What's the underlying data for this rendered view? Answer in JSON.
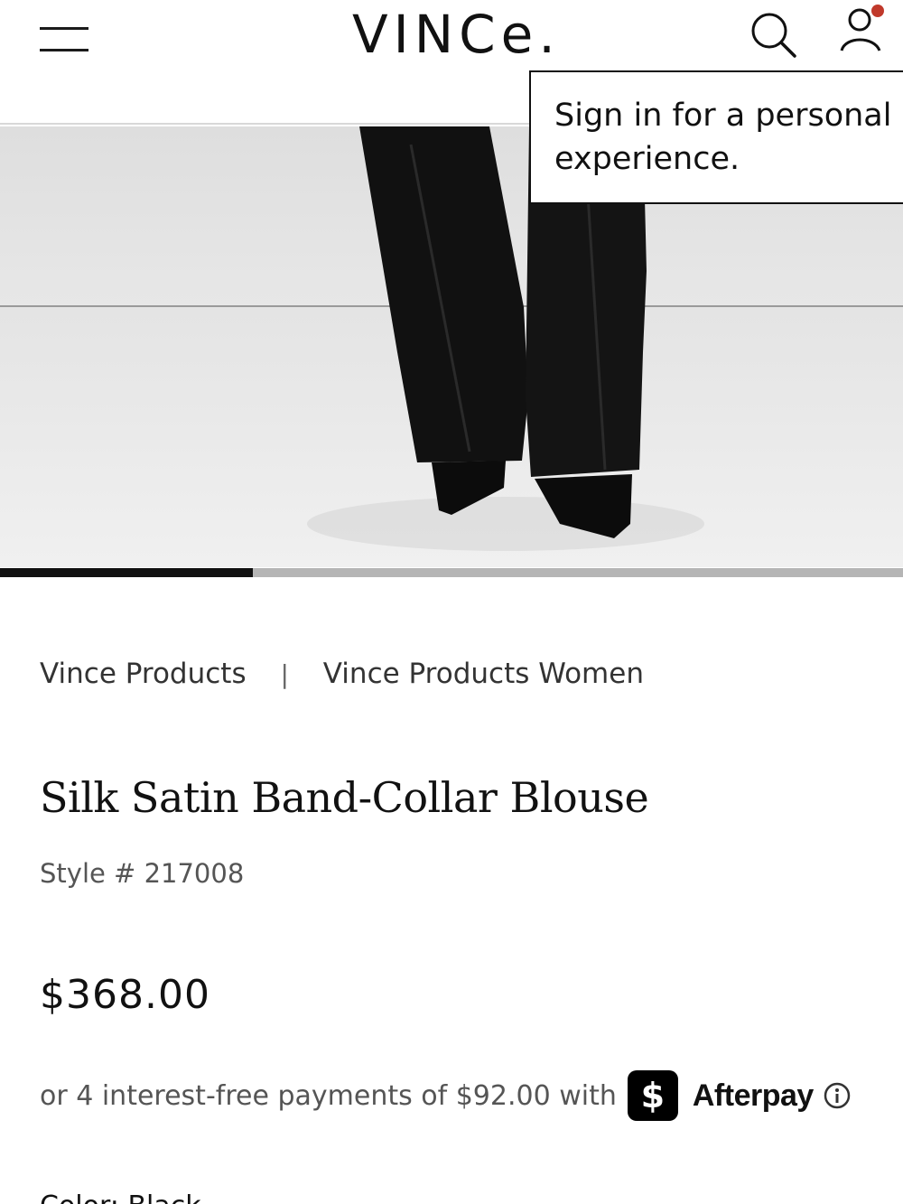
{
  "header": {
    "logo": "VINCe.",
    "menu_icon": "hamburger-menu-icon",
    "search_icon": "search-icon",
    "account_icon": "account-icon",
    "notification_dot_color": "#c0392b"
  },
  "tooltip": {
    "text_line1": "Sign in for a personal",
    "text_line2": "experience."
  },
  "carousel": {
    "progress": 0.28
  },
  "breadcrumb": {
    "items": [
      "Vince Products",
      "Vince Products Women"
    ],
    "separator": "|"
  },
  "product": {
    "title": "Silk Satin Band-Collar Blouse",
    "style": "Style # 217008",
    "price": "$368.00",
    "afterpay_text": "or 4 interest-free payments of $92.00 with",
    "afterpay_brand": "Afterpay",
    "cashapp_glyph": "$",
    "next_section_peek": "Color: Black"
  },
  "colors": {
    "text": "#111111",
    "muted": "#555555",
    "accent_dot": "#c0392b"
  }
}
